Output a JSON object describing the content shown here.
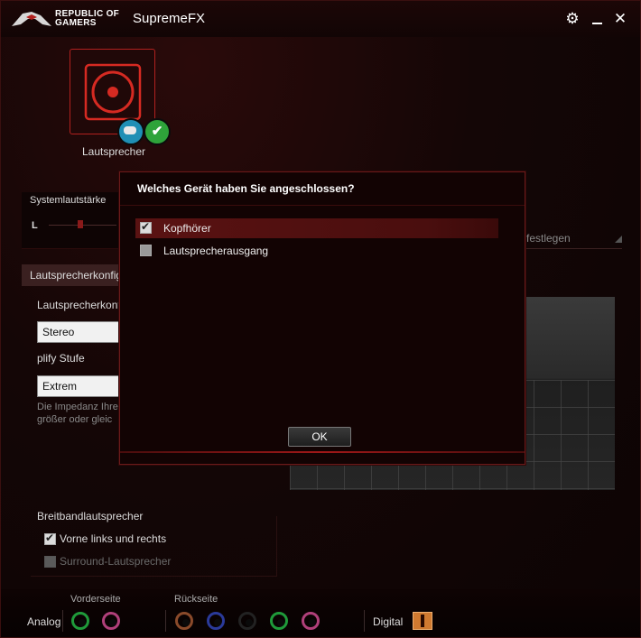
{
  "titlebar": {
    "brand_line1": "REPUBLIC OF",
    "brand_line2": "GAMERS",
    "app_title": "SupremeFX",
    "settings_icon": "gear-icon",
    "minimize_icon": "minimize-icon",
    "close_icon": "close-icon"
  },
  "device": {
    "label": "Lautsprecher"
  },
  "system_volume": {
    "label": "Systemlautstärke",
    "left_label": "L"
  },
  "speaker_config": {
    "tab_label": "Lautsprecherkonfig",
    "config_label": "Lautsprecherkonf",
    "config_value": "Stereo",
    "amp_label": "plify Stufe",
    "amp_value": "Extrem",
    "hint_line1": "Die Impedanz Ihre",
    "hint_line2": "größer oder gleic",
    "default_button": "festlegen"
  },
  "fullrange": {
    "title": "Breitbandlautsprecher",
    "front": "Vorne links und rechts",
    "surround": "Surround-Lautsprecher"
  },
  "jacks": {
    "analog_label": "Analog",
    "front_label": "Vorderseite",
    "rear_label": "Rückseite",
    "digital_label": "Digital",
    "front_colors": [
      "#1f9a3a",
      "#b0407a"
    ],
    "rear_colors": [
      "#8a4a2a",
      "#2a3a9a",
      "#222222",
      "#1f9a3a",
      "#b0407a"
    ]
  },
  "dialog": {
    "title": "Welches Gerät haben Sie angeschlossen?",
    "options": [
      "Kopfhörer",
      "Lautsprecherausgang"
    ],
    "selected_index": 0,
    "ok_label": "OK"
  },
  "colors": {
    "accent": "#b2211f"
  }
}
